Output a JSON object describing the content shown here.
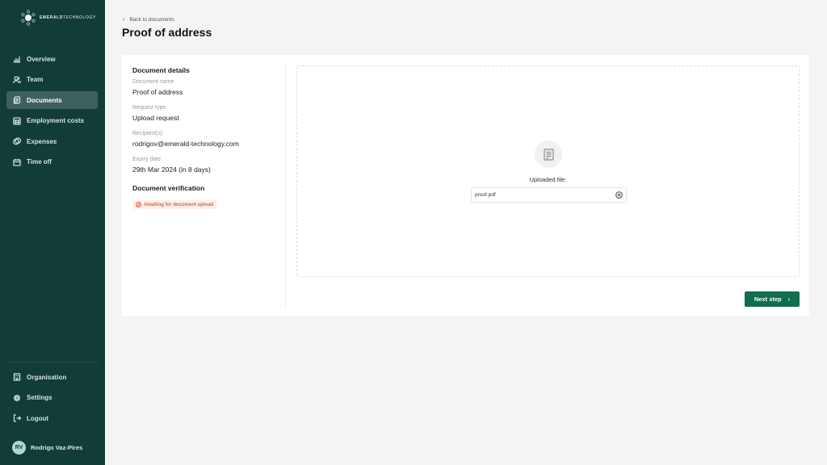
{
  "brand": {
    "name_bold": "EMERALD",
    "name_light": "TECHNOLOGY"
  },
  "sidebar": {
    "items": [
      {
        "label": "Overview",
        "icon": "bar-chart-icon"
      },
      {
        "label": "Team",
        "icon": "users-icon"
      },
      {
        "label": "Documents",
        "icon": "documents-icon",
        "active": true
      },
      {
        "label": "Employment costs",
        "icon": "calculator-icon"
      },
      {
        "label": "Expenses",
        "icon": "coins-icon"
      },
      {
        "label": "Time off",
        "icon": "calendar-icon"
      }
    ],
    "bottom_items": [
      {
        "label": "Organisation",
        "icon": "building-icon"
      },
      {
        "label": "Settings",
        "icon": "gear-icon"
      },
      {
        "label": "Logout",
        "icon": "logout-icon"
      }
    ],
    "user": {
      "initials": "RV",
      "name": "Rodrigo Vaz-Pires"
    }
  },
  "header": {
    "back_label": "Back to documents",
    "title": "Proof of address"
  },
  "details": {
    "title": "Document details",
    "fields": [
      {
        "label": "Document name",
        "value": "Proof of address"
      },
      {
        "label": "Request type",
        "value": "Upload request"
      },
      {
        "label": "Recipient(s)",
        "value": "rodrigov@emerald-technology.com"
      },
      {
        "label": "Expiry date",
        "value": "29th Mar 2024 (in 8 days)"
      }
    ],
    "verification_title": "Document verification",
    "verification_status": "Awaiting for document upload",
    "status_color": "#e2683a"
  },
  "upload": {
    "uploaded_label": "Uploaded file:",
    "file_name": "proof.pdf"
  },
  "actions": {
    "next_label": "Next step"
  },
  "colors": {
    "sidebar_bg": "#113c38",
    "accent": "#0f6e4c",
    "active_item": "#3d605c"
  }
}
